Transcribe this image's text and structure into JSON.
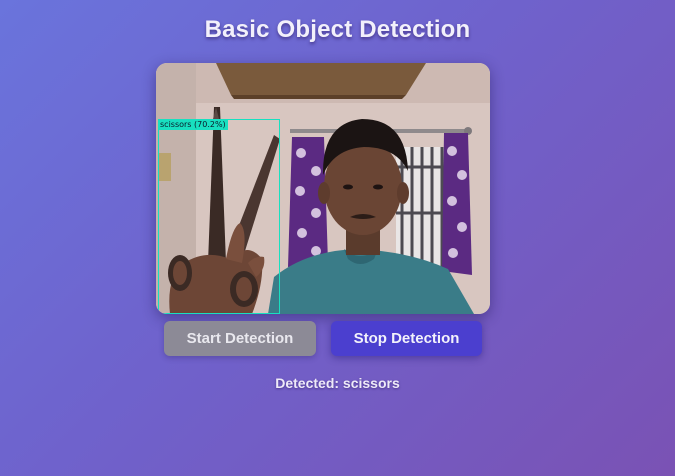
{
  "page": {
    "title": "Basic Object Detection"
  },
  "video": {
    "detection_label": "scissors (70.2%)",
    "box_color": "#18e0c0"
  },
  "controls": {
    "start_label": "Start Detection",
    "stop_label": "Stop Detection"
  },
  "status": {
    "text": "Detected: scissors"
  }
}
